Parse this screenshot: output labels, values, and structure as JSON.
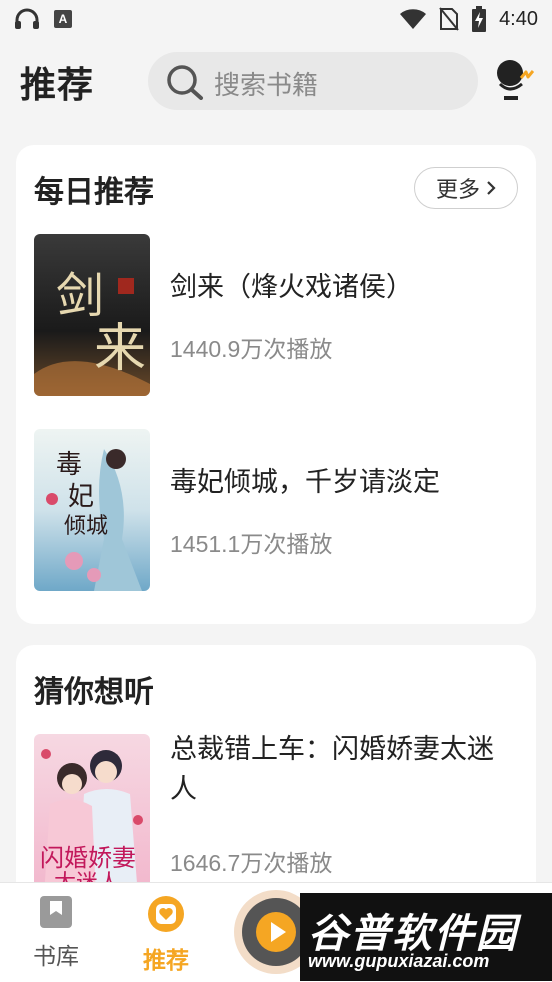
{
  "status_bar": {
    "time": "4:40",
    "badge_letter": "A"
  },
  "header": {
    "title": "推荐",
    "search_placeholder": "搜索书籍"
  },
  "daily": {
    "title": "每日推荐",
    "more_label": "更多",
    "books": [
      {
        "title": "剑来（烽火戏诸侯）",
        "plays": "1440.9万次播放",
        "cover_text": "剑来"
      },
      {
        "title": "毒妃倾城，千岁请淡定",
        "plays": "1451.1万次播放",
        "cover_text": "毒妃倾城"
      }
    ]
  },
  "guess": {
    "title": "猜你想听",
    "books": [
      {
        "title": "总裁错上车：闪婚娇妻太迷人",
        "plays": "1646.7万次播放",
        "cover_text": "闪婚娇妻太迷人"
      }
    ]
  },
  "bottom_nav": {
    "items": [
      {
        "label": "书库",
        "icon": "bookmark-icon",
        "active": false
      },
      {
        "label": "推荐",
        "icon": "heart-icon",
        "active": true
      }
    ],
    "accent_color": "#f5a623"
  },
  "watermark": {
    "text": "谷普软件园",
    "url": "www.gupuxiazai.com"
  }
}
